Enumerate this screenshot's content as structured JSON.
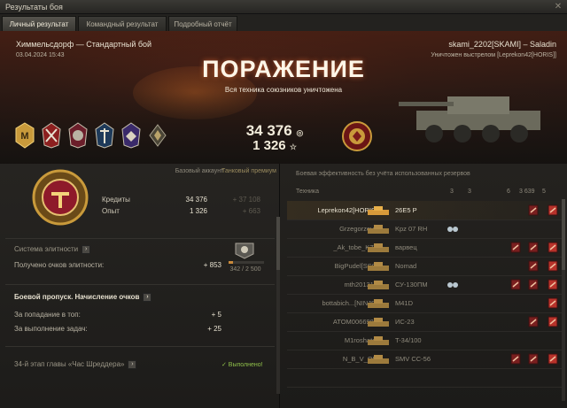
{
  "window": {
    "title": "Результаты боя",
    "close_icon": "close-icon"
  },
  "tabs": [
    {
      "label": "Личный результат",
      "active": true
    },
    {
      "label": "Командный результат",
      "active": false
    },
    {
      "label": "Подробный отчёт",
      "active": false
    }
  ],
  "banner": {
    "map_mode": "Химмельсдорф — Стандартный бой",
    "datetime": "03.04.2024 15:43",
    "player": "skami_2202[SKAMI] – Saladin",
    "killed_by": "Уничтожен выстрелом [Leprekon42[HORIS]]",
    "result": "ПОРАЖЕНИЕ",
    "result_sub": "Вся техника союзников уничтожена",
    "medals": [
      "mastery-badge-m",
      "medal-crossed-swords",
      "medal-stars",
      "medal-shield",
      "medal-eagle",
      "medal-rank"
    ],
    "total_credits": "34 376",
    "total_xp": "1 326",
    "team_medal": "team-achievement-medal",
    "colors": {
      "victory_red": "#b8322a",
      "gold": "#c99a3b"
    }
  },
  "personal": {
    "col_base": "Базовый аккаунт",
    "col_premium": "Танковый премиум",
    "credits_label": "Кредиты",
    "credits_base": "34 376",
    "credits_premium": "+ 37 108",
    "xp_label": "Опыт",
    "xp_base": "1 326",
    "xp_premium": "+ 663",
    "elite_title": "Система элитности",
    "elite_points_label": "Получено очков элитности:",
    "elite_points": "+ 853",
    "elite_progress": "342 / 2 500",
    "elite_progress_fraction": 0.137,
    "bp_title": "Боевой пропуск. Начисление очков",
    "bp_top_label": "За попадание в топ:",
    "bp_top_value": "+ 5",
    "bp_tasks_label": "За выполнение задач:",
    "bp_tasks_value": "+ 25",
    "chapter_title": "34-й этап главы «Час Шреддера»",
    "chapter_status": "✓ Выполнено!"
  },
  "efficiency": {
    "heading": "Боевая эффективность без учёта использованных резервов",
    "col_vehicle": "Техника",
    "col_icons": [
      "3",
      "3",
      "6",
      "3 639",
      "5"
    ],
    "rows": [
      {
        "player": "Leprekon42[HORIS]",
        "tank": "26E5 P",
        "me": true,
        "dots": false,
        "cells": [
          "",
          "",
          "",
          "dmg",
          "kill"
        ]
      },
      {
        "player": "Grzegorzeva",
        "tank": "Kpz 07 RH",
        "me": false,
        "dots": true,
        "cells": [
          "",
          "",
          "",
          "",
          ""
        ]
      },
      {
        "player": "_Ak_tobe_KZ_",
        "tank": "варвец",
        "me": false,
        "dots": false,
        "cells": [
          "",
          "",
          "dmg",
          "dmg",
          "kill"
        ]
      },
      {
        "player": "BigPudel[SS0]",
        "tank": "Nomad",
        "me": false,
        "dots": false,
        "cells": [
          "",
          "",
          "",
          "dmg",
          "kill"
        ]
      },
      {
        "player": "mth201313",
        "tank": "СУ-130ПМ",
        "me": false,
        "dots": true,
        "cells": [
          "",
          "",
          "dmg",
          "dmg",
          "kill"
        ]
      },
      {
        "player": "bottabich...[NINJS]",
        "tank": "M41D",
        "me": false,
        "dots": false,
        "cells": [
          "",
          "",
          "",
          "",
          "kill"
        ]
      },
      {
        "player": "ATOM0066981",
        "tank": "ИС-23",
        "me": false,
        "dots": false,
        "cells": [
          "",
          "",
          "",
          "dmg",
          "kill"
        ]
      },
      {
        "player": "M1roshatel",
        "tank": "T-34/100",
        "me": false,
        "dots": false,
        "cells": [
          "",
          "",
          "",
          "",
          ""
        ]
      },
      {
        "player": "N_B_V_QR",
        "tank": "SMV CC-56",
        "me": false,
        "dots": false,
        "cells": [
          "",
          "",
          "dmg",
          "dmg",
          "kill"
        ]
      },
      {
        "player": "",
        "tank": "",
        "me": false,
        "dots": false,
        "cells": [
          "",
          "",
          "",
          "",
          ""
        ]
      }
    ]
  }
}
